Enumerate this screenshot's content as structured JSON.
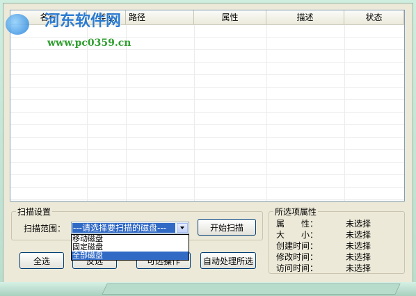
{
  "watermark": {
    "title": "河东软件网",
    "url": "www.pc0359.cn"
  },
  "table": {
    "columns": [
      "名称",
      "类型",
      "路径",
      "属性",
      "描述",
      "状态"
    ],
    "rows": []
  },
  "scan_settings": {
    "group_label": "扫描设置",
    "range_label": "扫描范围：",
    "combo_value": "---请选择要扫描的磁盘---",
    "options": [
      "移动磁盘",
      "固定磁盘",
      "全部磁盘"
    ],
    "selected_option": "全部磁盘",
    "start_button": "开始扫描"
  },
  "actions": {
    "select_all": "全选",
    "invert": "反选",
    "operate_selected": "可选操作",
    "auto_process": "自动处理所选"
  },
  "selected_props": {
    "group_label": "所选项属性",
    "items": [
      {
        "key": "属　　性：",
        "value": "未选择"
      },
      {
        "key": "大　　小：",
        "value": "未选择"
      },
      {
        "key": "创建时间：",
        "value": "未选择"
      },
      {
        "key": "修改时间：",
        "value": "未选择"
      },
      {
        "key": "访问时间：",
        "value": "未选择"
      }
    ]
  }
}
